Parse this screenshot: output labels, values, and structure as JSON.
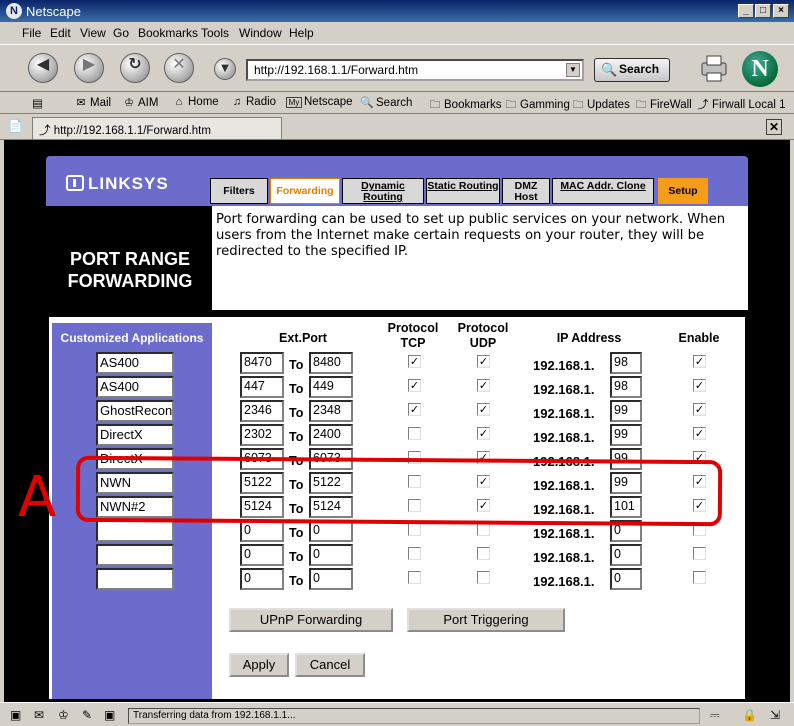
{
  "window": {
    "title": "Netscape",
    "controls": [
      "_",
      "□",
      "×"
    ]
  },
  "menu": [
    "File",
    "Edit",
    "View",
    "Go",
    "Bookmarks",
    "Tools",
    "Window",
    "Help"
  ],
  "navigation": {
    "url": "http://192.168.1.1/Forward.htm",
    "search_label": "Search"
  },
  "personal_toolbar": [
    "Mail",
    "AIM",
    "Home",
    "Radio",
    "Netscape",
    "Search",
    "Bookmarks",
    "Gamming",
    "Updates",
    "FireWall",
    "Firwall Local 1"
  ],
  "tab": {
    "url": "http://192.168.1.1/Forward.htm"
  },
  "status": {
    "text": "Transferring data from 192.168.1.1..."
  },
  "router": {
    "brand": "LINKSYS",
    "tabs": [
      {
        "label": "Filters",
        "state": "normal"
      },
      {
        "label": "Forwarding",
        "state": "active"
      },
      {
        "label": "Dynamic Routing",
        "state": "normal"
      },
      {
        "label": "Static Routing",
        "state": "normal"
      },
      {
        "label": "DMZ Host",
        "state": "normal"
      },
      {
        "label": "MAC Addr. Clone",
        "state": "normal"
      },
      {
        "label": "Setup",
        "state": "highlight"
      }
    ],
    "page_title": "PORT RANGE FORWARDING",
    "description": "Port forwarding can be used to set up public services on your network. When users from the Internet make certain requests on your router, they will be redirected to the specified IP.",
    "columns": {
      "apps": "Customized Applications",
      "ext_port": "Ext.Port",
      "tcp": "Protocol TCP",
      "udp": "Protocol UDP",
      "ip": "IP Address",
      "enable": "Enable"
    },
    "to_label": "To",
    "ip_prefix": "192.168.1.",
    "rows": [
      {
        "app": "AS400",
        "from": "8470",
        "to": "8480",
        "tcp": true,
        "udp": true,
        "ip": "98",
        "enable": true
      },
      {
        "app": "AS400",
        "from": "447",
        "to": "449",
        "tcp": true,
        "udp": true,
        "ip": "98",
        "enable": true
      },
      {
        "app": "GhostRecon",
        "from": "2346",
        "to": "2348",
        "tcp": true,
        "udp": true,
        "ip": "99",
        "enable": true
      },
      {
        "app": "DirectX",
        "from": "2302",
        "to": "2400",
        "tcp": false,
        "udp": true,
        "ip": "99",
        "enable": true
      },
      {
        "app": "DirectX",
        "from": "6073",
        "to": "6073",
        "tcp": false,
        "udp": true,
        "ip": "99",
        "enable": true
      },
      {
        "app": "NWN",
        "from": "5122",
        "to": "5122",
        "tcp": false,
        "udp": true,
        "ip": "99",
        "enable": true
      },
      {
        "app": "NWN#2",
        "from": "5124",
        "to": "5124",
        "tcp": false,
        "udp": true,
        "ip": "101",
        "enable": true
      },
      {
        "app": "",
        "from": "0",
        "to": "0",
        "tcp": false,
        "udp": false,
        "ip": "0",
        "enable": false
      },
      {
        "app": "",
        "from": "0",
        "to": "0",
        "tcp": false,
        "udp": false,
        "ip": "0",
        "enable": false
      },
      {
        "app": "",
        "from": "0",
        "to": "0",
        "tcp": false,
        "udp": false,
        "ip": "0",
        "enable": false
      }
    ],
    "buttons": {
      "upnp": "UPnP Forwarding",
      "triggering": "Port Triggering",
      "apply": "Apply",
      "cancel": "Cancel"
    }
  },
  "annotation": {
    "letter": "A",
    "color": "#e00000"
  },
  "colors": {
    "linksys_purple": "#6c6ccc",
    "active_tab_text": "#e08000",
    "setup_tab": "#f59c1a"
  }
}
